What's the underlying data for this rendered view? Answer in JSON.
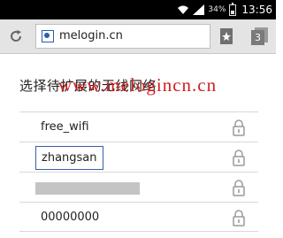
{
  "status_bar": {
    "battery_percent": "34%",
    "time": "13:56"
  },
  "browser": {
    "url": "melogin.cn",
    "tab_count": "3"
  },
  "page": {
    "heading": "选择待扩展的无线网络",
    "watermark": "www.melogincn.cn"
  },
  "networks": [
    {
      "ssid": "free_wifi",
      "secured": true
    },
    {
      "ssid": "zhangsan",
      "secured": true,
      "highlighted": true
    },
    {
      "ssid": "",
      "secured": true,
      "obscured": true
    },
    {
      "ssid": "00000000",
      "secured": true
    }
  ],
  "colors": {
    "status_bar_bg": "#000000",
    "toolbar_bg": "#e4e4e4",
    "highlight_border": "#3a5ea8",
    "watermark": "#d02020"
  }
}
